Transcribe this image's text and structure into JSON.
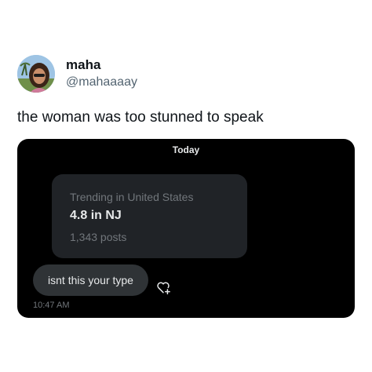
{
  "tweet": {
    "display_name": "maha",
    "handle": "@mahaaaay",
    "text": "the woman was too stunned to speak"
  },
  "dm_screenshot": {
    "date_separator": "Today",
    "trend_card": {
      "context": "Trending in United States",
      "name": "4.8 in NJ",
      "post_count": "1,343 posts"
    },
    "message": "isnt this your type",
    "timestamp": "10:47 AM",
    "reaction_icon": "heart-plus-icon"
  }
}
